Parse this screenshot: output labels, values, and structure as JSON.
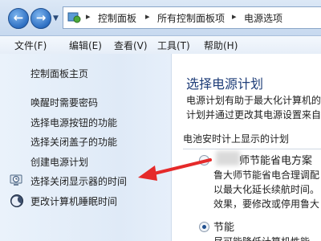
{
  "breadcrumb": [
    "控制面板",
    "所有控制面板项",
    "电源选项"
  ],
  "menu": [
    {
      "label": "文件(F)"
    },
    {
      "label": "编辑(E)"
    },
    {
      "label": "查看(V)"
    },
    {
      "label": "工具(T)"
    },
    {
      "label": "帮助(H)"
    }
  ],
  "sidebar": {
    "home": "控制面板主页",
    "items": [
      {
        "label": "唤醒时需要密码"
      },
      {
        "label": "选择电源按钮的功能"
      },
      {
        "label": "选择关闭盖子的功能"
      },
      {
        "label": "创建电源计划"
      },
      {
        "label": "选择关闭显示器的时间",
        "icon": "monitor-clock-icon"
      },
      {
        "label": "更改计算机睡眠时间",
        "icon": "moon-icon"
      }
    ]
  },
  "main": {
    "title": "选择电源计划",
    "desc_lines": [
      "电源计划有助于最大化计算机的",
      "计划并通过更改其电源设置来自"
    ],
    "group_label": "电池安时计上显示的计划",
    "plans": [
      {
        "name": "师节能省电方案",
        "desc_lines": [
          "鲁大师节能省电合理调配",
          "以最大化延长续航时间。",
          "效果，要修改或停用鲁大"
        ],
        "selected": false
      },
      {
        "name": "节能",
        "desc_lines": [
          "尽可能降低计算机性能"
        ],
        "selected": true
      }
    ]
  },
  "colors": {
    "accent_arrow": "#e52a2a",
    "title_blue": "#1e3d78",
    "link_bg": "#e3edf9"
  }
}
